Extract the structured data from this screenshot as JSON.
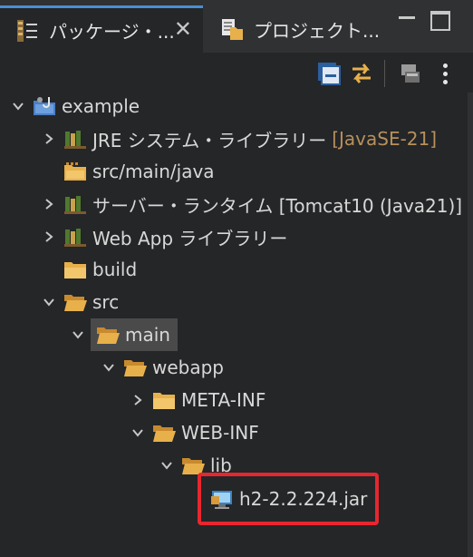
{
  "tabs": [
    {
      "label": "パッケージ・...",
      "close": "✕"
    },
    {
      "label": "プロジェクト..."
    }
  ],
  "toolbar": {
    "collapse_all": "collapse-all",
    "link_editor": "link-with-editor",
    "filter": "filter",
    "view_menu": "view-menu"
  },
  "tree": {
    "project": "example",
    "jre": {
      "label": "JRE システム・ライブラリー",
      "decoration": "[JavaSE-21]"
    },
    "src_main_java": "src/main/java",
    "server_runtime": "サーバー・ランタイム [Tomcat10 (Java21)]",
    "webapp_libraries": "Web App ライブラリー",
    "build": "build",
    "src": "src",
    "main": "main",
    "webapp": "webapp",
    "meta_inf": "META-INF",
    "web_inf": "WEB-INF",
    "lib": "lib",
    "jar": "h2-2.2.224.jar"
  },
  "colors": {
    "folder": "#e8b04b",
    "highlight": "#e8262f",
    "decoration": "#b8905a",
    "tab_accent": "#4a8fd1"
  }
}
